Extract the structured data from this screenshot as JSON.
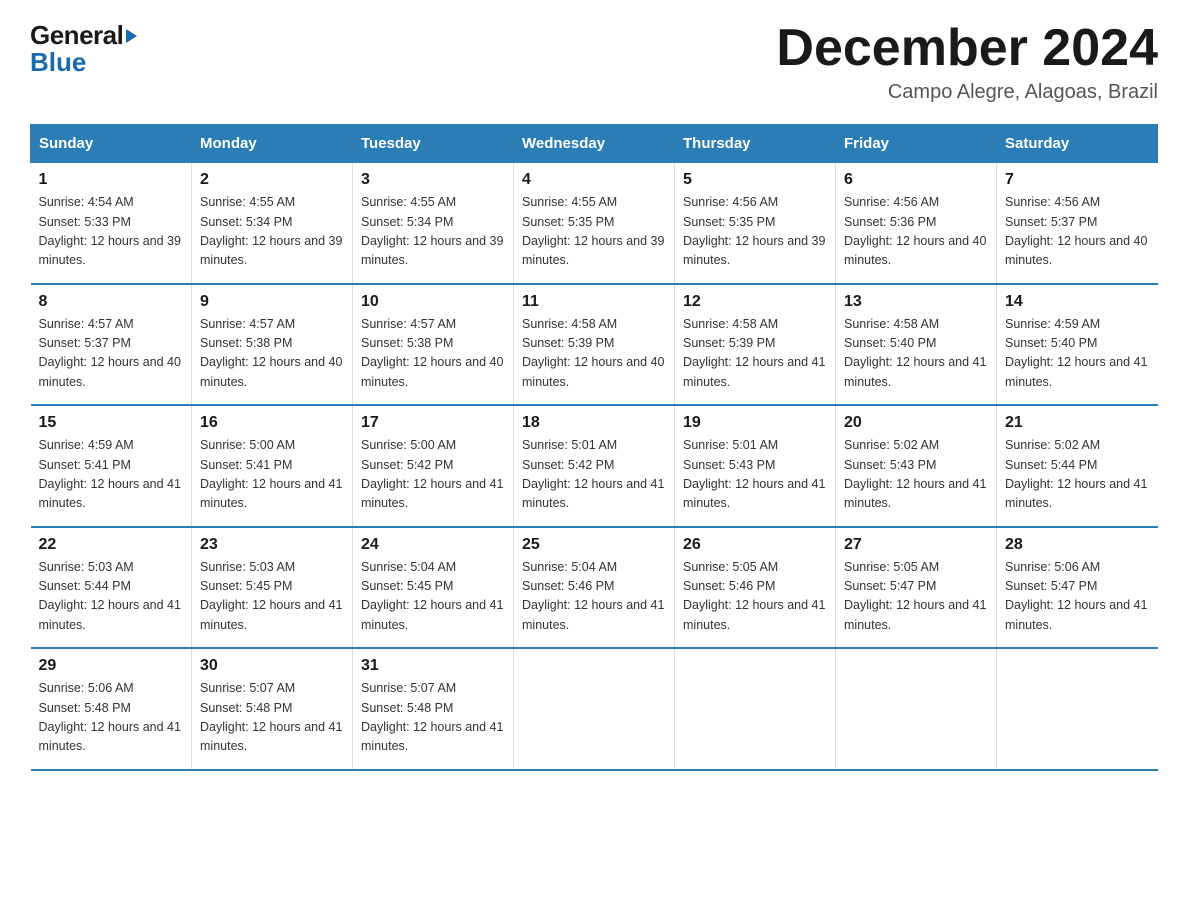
{
  "logo": {
    "general": "General",
    "arrow": "▶",
    "blue": "Blue"
  },
  "title": "December 2024",
  "subtitle": "Campo Alegre, Alagoas, Brazil",
  "days_of_week": [
    "Sunday",
    "Monday",
    "Tuesday",
    "Wednesday",
    "Thursday",
    "Friday",
    "Saturday"
  ],
  "weeks": [
    [
      {
        "day": "1",
        "sunrise": "4:54 AM",
        "sunset": "5:33 PM",
        "daylight": "12 hours and 39 minutes."
      },
      {
        "day": "2",
        "sunrise": "4:55 AM",
        "sunset": "5:34 PM",
        "daylight": "12 hours and 39 minutes."
      },
      {
        "day": "3",
        "sunrise": "4:55 AM",
        "sunset": "5:34 PM",
        "daylight": "12 hours and 39 minutes."
      },
      {
        "day": "4",
        "sunrise": "4:55 AM",
        "sunset": "5:35 PM",
        "daylight": "12 hours and 39 minutes."
      },
      {
        "day": "5",
        "sunrise": "4:56 AM",
        "sunset": "5:35 PM",
        "daylight": "12 hours and 39 minutes."
      },
      {
        "day": "6",
        "sunrise": "4:56 AM",
        "sunset": "5:36 PM",
        "daylight": "12 hours and 40 minutes."
      },
      {
        "day": "7",
        "sunrise": "4:56 AM",
        "sunset": "5:37 PM",
        "daylight": "12 hours and 40 minutes."
      }
    ],
    [
      {
        "day": "8",
        "sunrise": "4:57 AM",
        "sunset": "5:37 PM",
        "daylight": "12 hours and 40 minutes."
      },
      {
        "day": "9",
        "sunrise": "4:57 AM",
        "sunset": "5:38 PM",
        "daylight": "12 hours and 40 minutes."
      },
      {
        "day": "10",
        "sunrise": "4:57 AM",
        "sunset": "5:38 PM",
        "daylight": "12 hours and 40 minutes."
      },
      {
        "day": "11",
        "sunrise": "4:58 AM",
        "sunset": "5:39 PM",
        "daylight": "12 hours and 40 minutes."
      },
      {
        "day": "12",
        "sunrise": "4:58 AM",
        "sunset": "5:39 PM",
        "daylight": "12 hours and 41 minutes."
      },
      {
        "day": "13",
        "sunrise": "4:58 AM",
        "sunset": "5:40 PM",
        "daylight": "12 hours and 41 minutes."
      },
      {
        "day": "14",
        "sunrise": "4:59 AM",
        "sunset": "5:40 PM",
        "daylight": "12 hours and 41 minutes."
      }
    ],
    [
      {
        "day": "15",
        "sunrise": "4:59 AM",
        "sunset": "5:41 PM",
        "daylight": "12 hours and 41 minutes."
      },
      {
        "day": "16",
        "sunrise": "5:00 AM",
        "sunset": "5:41 PM",
        "daylight": "12 hours and 41 minutes."
      },
      {
        "day": "17",
        "sunrise": "5:00 AM",
        "sunset": "5:42 PM",
        "daylight": "12 hours and 41 minutes."
      },
      {
        "day": "18",
        "sunrise": "5:01 AM",
        "sunset": "5:42 PM",
        "daylight": "12 hours and 41 minutes."
      },
      {
        "day": "19",
        "sunrise": "5:01 AM",
        "sunset": "5:43 PM",
        "daylight": "12 hours and 41 minutes."
      },
      {
        "day": "20",
        "sunrise": "5:02 AM",
        "sunset": "5:43 PM",
        "daylight": "12 hours and 41 minutes."
      },
      {
        "day": "21",
        "sunrise": "5:02 AM",
        "sunset": "5:44 PM",
        "daylight": "12 hours and 41 minutes."
      }
    ],
    [
      {
        "day": "22",
        "sunrise": "5:03 AM",
        "sunset": "5:44 PM",
        "daylight": "12 hours and 41 minutes."
      },
      {
        "day": "23",
        "sunrise": "5:03 AM",
        "sunset": "5:45 PM",
        "daylight": "12 hours and 41 minutes."
      },
      {
        "day": "24",
        "sunrise": "5:04 AM",
        "sunset": "5:45 PM",
        "daylight": "12 hours and 41 minutes."
      },
      {
        "day": "25",
        "sunrise": "5:04 AM",
        "sunset": "5:46 PM",
        "daylight": "12 hours and 41 minutes."
      },
      {
        "day": "26",
        "sunrise": "5:05 AM",
        "sunset": "5:46 PM",
        "daylight": "12 hours and 41 minutes."
      },
      {
        "day": "27",
        "sunrise": "5:05 AM",
        "sunset": "5:47 PM",
        "daylight": "12 hours and 41 minutes."
      },
      {
        "day": "28",
        "sunrise": "5:06 AM",
        "sunset": "5:47 PM",
        "daylight": "12 hours and 41 minutes."
      }
    ],
    [
      {
        "day": "29",
        "sunrise": "5:06 AM",
        "sunset": "5:48 PM",
        "daylight": "12 hours and 41 minutes."
      },
      {
        "day": "30",
        "sunrise": "5:07 AM",
        "sunset": "5:48 PM",
        "daylight": "12 hours and 41 minutes."
      },
      {
        "day": "31",
        "sunrise": "5:07 AM",
        "sunset": "5:48 PM",
        "daylight": "12 hours and 41 minutes."
      },
      null,
      null,
      null,
      null
    ]
  ],
  "colors": {
    "header_bg": "#2a7db5",
    "header_text": "#ffffff",
    "border": "#2a7db5",
    "logo_blue": "#1a6ab0"
  }
}
